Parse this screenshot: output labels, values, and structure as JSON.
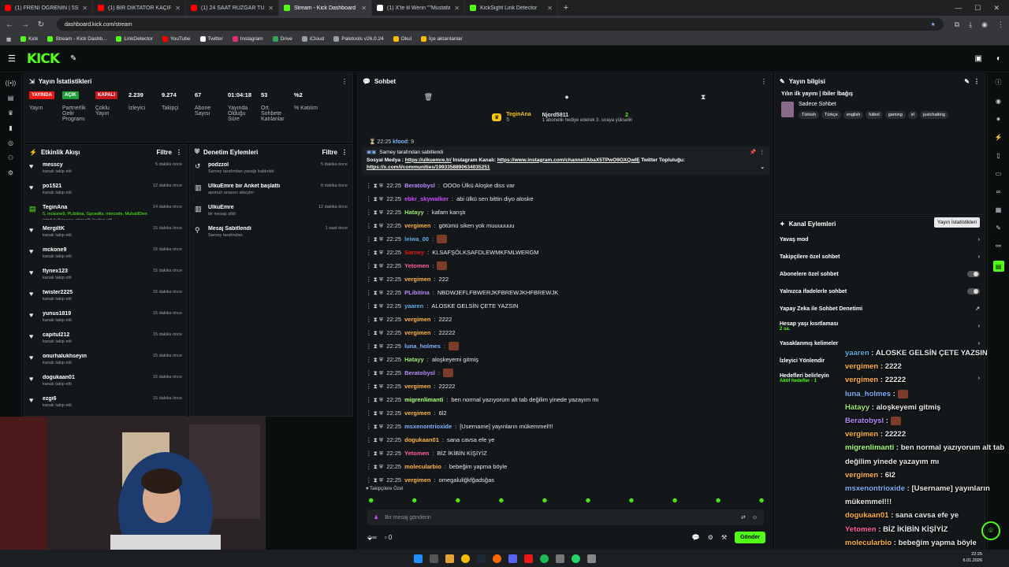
{
  "browser": {
    "tabs": [
      {
        "title": "(1) FRENİ ÖĞRENİN | 5Sriders |",
        "color": "#ff0000",
        "active": false
      },
      {
        "title": "(1) BİR DİKTATÖR KAÇIRILIRSA",
        "color": "#ff0000",
        "active": false
      },
      {
        "title": "(1) 24 SAAT RÜZGAR TÜRBİNİ",
        "color": "#ff0000",
        "active": false
      },
      {
        "title": "Stream - Kick Dashboard",
        "color": "#53fc18",
        "active": true
      },
      {
        "title": "(1) X'te lil Wenn \"\"Mustafa kem",
        "color": "#ffffff",
        "active": false
      },
      {
        "title": "KickSight Link Detector",
        "color": "#53fc18",
        "active": false
      }
    ],
    "url": "dashboard.kick.com/stream",
    "bookmarks": [
      {
        "label": "Kick",
        "color": "#53fc18"
      },
      {
        "label": "Stream - Kick Dashb...",
        "color": "#53fc18"
      },
      {
        "label": "LinkDetector",
        "color": "#53fc18"
      },
      {
        "label": "YouTube",
        "color": "#ff0000"
      },
      {
        "label": "Twitter",
        "color": "#ffffff"
      },
      {
        "label": "Instagram",
        "color": "#e1306c"
      },
      {
        "label": "Drive",
        "color": "#34a853"
      },
      {
        "label": "iCloud",
        "color": "#9aa0a6"
      },
      {
        "label": "Paletools v26.0.24",
        "color": "#9aa0a6"
      },
      {
        "label": "Okul",
        "color": "#fbbc04"
      },
      {
        "label": "İçe aktarılanlar",
        "color": "#fbbc04"
      }
    ]
  },
  "kick": {
    "logo": "KICK"
  },
  "stats": {
    "title": "Yayın İstatistikleri",
    "items": [
      {
        "badge": "YAYINDA",
        "badge_color": "#e91916",
        "label": "Yayın"
      },
      {
        "badge": "AÇIK",
        "badge_color": "#1f9e3a",
        "label": "Partnerlik Gelir Programı"
      },
      {
        "badge": "KAPALI",
        "badge_color": "#c4161c",
        "label": "Çoklu Yayın"
      },
      {
        "value": "2.239",
        "label": "İzleyici"
      },
      {
        "value": "9.274",
        "label": "Takipçi"
      },
      {
        "value": "67",
        "label": "Abone Sayısı"
      },
      {
        "value": "01:04:18",
        "label": "Yayında Olduğu Süre"
      },
      {
        "value": "53",
        "label": "Ort. Sohbete Katılanlar"
      },
      {
        "value": "%2",
        "label": "% Katılım"
      }
    ]
  },
  "activity": {
    "title": "Etkinlik Akışı",
    "filter": "Filtre",
    "items": [
      {
        "name": "messcy",
        "sub": "kanalı takip etti",
        "time": "5 dakika önce",
        "icon": "♥",
        "green": false
      },
      {
        "name": "po1521",
        "sub": "kanalı takip etti",
        "time": "12 dakika önce",
        "icon": "♥",
        "green": false
      },
      {
        "name": "TeginAna",
        "sub": "5, mckone9, PLibitina, Gpcedits, mtecode, MuhalifDeniz",
        "sub2": "isimli kullanıcıya abonelik hediye etti.",
        "time": "14 dakika önce",
        "icon": "▤",
        "green": true
      },
      {
        "name": "MergiltK",
        "sub": "kanalı takip etti",
        "time": "15 dakika önce",
        "icon": "♥",
        "green": false
      },
      {
        "name": "mckone9",
        "sub": "kanalı takip etti",
        "time": "15 dakika önce",
        "icon": "♥",
        "green": false
      },
      {
        "name": "flynex123",
        "sub": "kanalı takip etti",
        "time": "15 dakika önce",
        "icon": "♥",
        "green": false
      },
      {
        "name": "twister2225",
        "sub": "kanalı takip etti",
        "time": "15 dakika önce",
        "icon": "♥",
        "green": false
      },
      {
        "name": "yunus1819",
        "sub": "kanalı takip etti",
        "time": "15 dakika önce",
        "icon": "♥",
        "green": false
      },
      {
        "name": "capitul212",
        "sub": "kanalı takip etti",
        "time": "15 dakika önce",
        "icon": "♥",
        "green": false
      },
      {
        "name": "onurhalukhseyin",
        "sub": "kanalı takip etti",
        "time": "15 dakika önce",
        "icon": "♥",
        "green": false
      },
      {
        "name": "dogukaan01",
        "sub": "kanalı takip etti",
        "time": "15 dakika önce",
        "icon": "♥",
        "green": false
      },
      {
        "name": "ezgi6",
        "sub": "kanalı takip etti",
        "time": "15 dakika önce",
        "icon": "♥",
        "green": false
      }
    ]
  },
  "moderation": {
    "title": "Denetim Eylemleri",
    "filter": "Filtre",
    "items": [
      {
        "name": "podzzol",
        "sub": "Sarney tarafından yasağı kaldırıldı",
        "time": "5 dakika önce",
        "icon": "↺"
      },
      {
        "name": "UlkuEmre bir Anket başlattı",
        "sub": "aponun anasını sikeyim",
        "time": "8 dakika önce",
        "icon": "▥"
      },
      {
        "name": "UlkuEmre",
        "sub": "bir mesajı sildi",
        "time": "12 dakika önce",
        "icon": "▥"
      },
      {
        "name": "Mesaj Sabitlendi",
        "sub": "Sarney tarafından",
        "time": "1 saat önce",
        "icon": "⚲"
      }
    ]
  },
  "chat": {
    "title": "Sohbet",
    "sub_gift_user": "TeginAna",
    "sub_gift_count": "5",
    "sub_gift_target": "Njord5811",
    "sub_gift_text": "1 abonelik hediye ederek 3. sıraya yükselin",
    "sub_gift_right": "2",
    "pinned_by": "Sarney tarafından sabitlendi",
    "pinned_text_1": "Sosyal Medya : ",
    "pinned_link_1": "https://ulkuemre.tr/",
    "pinned_text_2": " Instagram Kanalı: ",
    "pinned_link_2": "https://www.instagram.com/channel/AbaX5TPwO9OXQwIE",
    "pinned_text_3": " Twitter Topluluğu: ",
    "pinned_link_3": "https://x.com/i/communities/1993358890634035251",
    "partial_user": "kfood",
    "partial_text": "9",
    "messages": [
      {
        "time": "22:25",
        "user": "Beratobysl",
        "color": "#b689ff",
        "text": "OOOo Ülkü Aloşke diss var",
        "emote": false
      },
      {
        "time": "22:25",
        "user": "ebkr_skywalker",
        "color": "#c84dff",
        "text": "abi ülkü sen bittin diyo aloske",
        "emote": false
      },
      {
        "time": "22:25",
        "user": "Hatayy",
        "color": "#9fe870",
        "text": "kafam karıştı",
        "emote": false
      },
      {
        "time": "22:25",
        "user": "vergimen",
        "color": "#ffb347",
        "text": "götümü siken yok muuuuuuu",
        "emote": false
      },
      {
        "time": "22:25",
        "user": "leiwa_00",
        "color": "#5dade2",
        "text": "",
        "emote": true
      },
      {
        "time": "22:25",
        "user": "Sarney",
        "color": "#e91916",
        "text": "KLSAFŞÖLKSAFDLEWMKFMLWERGM",
        "emote": false
      },
      {
        "time": "22:25",
        "user": "Yetomen",
        "color": "#ff5fa2",
        "text": "",
        "emote": true
      },
      {
        "time": "22:25",
        "user": "vergimen",
        "color": "#ffb347",
        "text": "222",
        "emote": false
      },
      {
        "time": "22:25",
        "user": "PLibitina",
        "color": "#b689ff",
        "text": "NBDWJEFLFBWERJKFBREWJKHFBREWJK",
        "emote": false
      },
      {
        "time": "22:25",
        "user": "yaaren",
        "color": "#5dade2",
        "text": "ALOSKE GELSİN ÇETE YAZSIN",
        "emote": false
      },
      {
        "time": "22:25",
        "user": "vergimen",
        "color": "#ffb347",
        "text": "2222",
        "emote": false
      },
      {
        "time": "22:25",
        "user": "vergimen",
        "color": "#ffb347",
        "text": "22222",
        "emote": false
      },
      {
        "time": "22:25",
        "user": "luna_holmes",
        "color": "#7fb2ff",
        "text": "",
        "emote": true
      },
      {
        "time": "22:25",
        "user": "Hatayy",
        "color": "#9fe870",
        "text": "aloşkeyemi gitmiş",
        "emote": false
      },
      {
        "time": "22:25",
        "user": "Beratobysl",
        "color": "#b689ff",
        "text": "",
        "emote": true
      },
      {
        "time": "22:25",
        "user": "vergimen",
        "color": "#ffb347",
        "text": "22222",
        "emote": false
      },
      {
        "time": "22:25",
        "user": "migrenlimanti",
        "color": "#a6ff7a",
        "text": "ben normal yazıyorum alt tab değilim yinede yazayım mı",
        "emote": false
      },
      {
        "time": "22:25",
        "user": "vergimen",
        "color": "#ffb347",
        "text": "6l2",
        "emote": false
      },
      {
        "time": "22:25",
        "user": "msxenontrioxide",
        "color": "#7fb2ff",
        "text": "[Username] yayınların mükemmel!!!",
        "emote": false
      },
      {
        "time": "22:25",
        "user": "dogukaan01",
        "color": "#ffb347",
        "text": "sana cavsa efe ye",
        "emote": false
      },
      {
        "time": "22:25",
        "user": "Yetomen",
        "color": "#ff5fa2",
        "text": "BİZ İKİBİN KİŞİYİZ",
        "emote": false
      },
      {
        "time": "22:25",
        "user": "molecularbio",
        "color": "#ffb347",
        "text": "bebeğim yapma böyle",
        "emote": false
      },
      {
        "time": "22:25",
        "user": "vergimen",
        "color": "#ffb347",
        "text": "omegaluliğkfğadsğas",
        "emote": false
      }
    ],
    "followers_only": "Takipçilere Özel",
    "input_placeholder": "Bir mesaj gönderin",
    "count": "0",
    "send_label": "Gönder"
  },
  "info": {
    "title": "Yayın bilgisi",
    "stream_title": "Yılın ilk yayını | Ibiler İbağış",
    "category": "Sadece Sohbet",
    "tags": [
      "Türkish",
      "Türkçe",
      "english",
      "futbol",
      "gaming",
      "irl",
      "justchatting"
    ]
  },
  "actions": {
    "title": "Kanal Eylemleri",
    "tooltip": "Yayın İstatistikleri",
    "rows": [
      {
        "label": "Yavaş mod",
        "control": "chevron"
      },
      {
        "label": "Takipçilere özel sohbet",
        "control": "chevron"
      },
      {
        "label": "Abonelere özel sohbet",
        "control": "toggle"
      },
      {
        "label": "Yalnızca ifadelerle sohbet",
        "control": "toggle"
      },
      {
        "label": "Yapay Zeka ile Sohbet Denetimi",
        "control": "ext"
      },
      {
        "label": "Hesap yaşı kısıtlaması",
        "sub": "2 sa.",
        "control": "chevron"
      },
      {
        "label": "Yasaklanmış kelimeler",
        "control": "chevron"
      },
      {
        "label": "İzleyici Yönlendir",
        "control": "none"
      },
      {
        "label": "Hedefleri belirleyin",
        "sub": "Aktif hedefler · 1",
        "control": "chevron"
      }
    ]
  },
  "overlay": [
    {
      "user": "yaaren",
      "color": "#5dade2",
      "text": "ALOSKE GELSİN ÇETE YAZSIN"
    },
    {
      "user": "vergimen",
      "color": "#ffb347",
      "text": "2222"
    },
    {
      "user": "vergimen",
      "color": "#ffb347",
      "text": "22222"
    },
    {
      "user": "luna_holmes",
      "color": "#7fb2ff",
      "text": ""
    },
    {
      "user": "Hatayy",
      "color": "#9fe870",
      "text": "aloşkeyemi gitmiş"
    },
    {
      "user": "Beratobysl",
      "color": "#b689ff",
      "text": ""
    },
    {
      "user": "vergimen",
      "color": "#ffb347",
      "text": "22222"
    },
    {
      "user": "migrenlimanti",
      "color": "#a6ff7a",
      "text": "ben normal yazıyorum alt tab değilim yinede yazayım mı"
    },
    {
      "user": "vergimen",
      "color": "#ffb347",
      "text": "6l2"
    },
    {
      "user": "msxenontrioxide",
      "color": "#7fb2ff",
      "text": "[Username] yayınların mükemmel!!!"
    },
    {
      "user": "dogukaan01",
      "color": "#ffb347",
      "text": "sana cavsa efe ye"
    },
    {
      "user": "Yetomen",
      "color": "#ff5fa2",
      "text": "BİZ İKİBİN KİŞİYİZ"
    },
    {
      "user": "molecularbio",
      "color": "#ffb347",
      "text": "bebeğim yapma böyle"
    },
    {
      "user": "vergimen",
      "color": "#ffb347",
      "text": "omegaluliğkfğadsğas"
    }
  ],
  "clock": {
    "time": "22:25",
    "date": "6.01.2026"
  },
  "colors": {
    "accent": "#53fc18",
    "bg": "#0b0e0f",
    "panel": "#141719"
  }
}
